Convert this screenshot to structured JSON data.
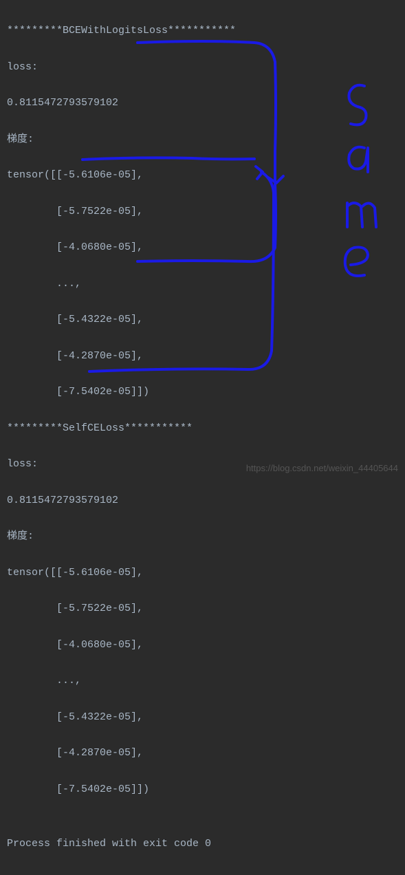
{
  "terminal": {
    "lines": {
      "header1": "*********BCEWithLogitsLoss***********",
      "loss_label1": "loss:",
      "loss_value1": "0.8115472793579102",
      "grad_label1": "梯度:",
      "tensor_open1": "tensor([[-5.6106e-05],",
      "tensor_l1_1": "        [-5.7522e-05],",
      "tensor_l1_2": "        [-4.0680e-05],",
      "tensor_ellipsis1": "        ...,",
      "tensor_l1_3": "        [-5.4322e-05],",
      "tensor_l1_4": "        [-4.2870e-05],",
      "tensor_l1_5": "        [-7.5402e-05]])",
      "header2": "*********SelfCELoss***********",
      "loss_label2": "loss:",
      "loss_value2": "0.8115472793579102",
      "grad_label2": "梯度:",
      "tensor_open2": "tensor([[-5.6106e-05],",
      "tensor_l2_1": "        [-5.7522e-05],",
      "tensor_l2_2": "        [-4.0680e-05],",
      "tensor_ellipsis2": "        ...,",
      "tensor_l2_3": "        [-5.4322e-05],",
      "tensor_l2_4": "        [-4.2870e-05],",
      "tensor_l2_5": "        [-7.5402e-05]])",
      "blank": "",
      "exit": "Process finished with exit code 0"
    }
  },
  "annotation": {
    "text": "same",
    "color": "#1a1ae6"
  },
  "watermark": "https://blog.csdn.net/weixin_44405644"
}
